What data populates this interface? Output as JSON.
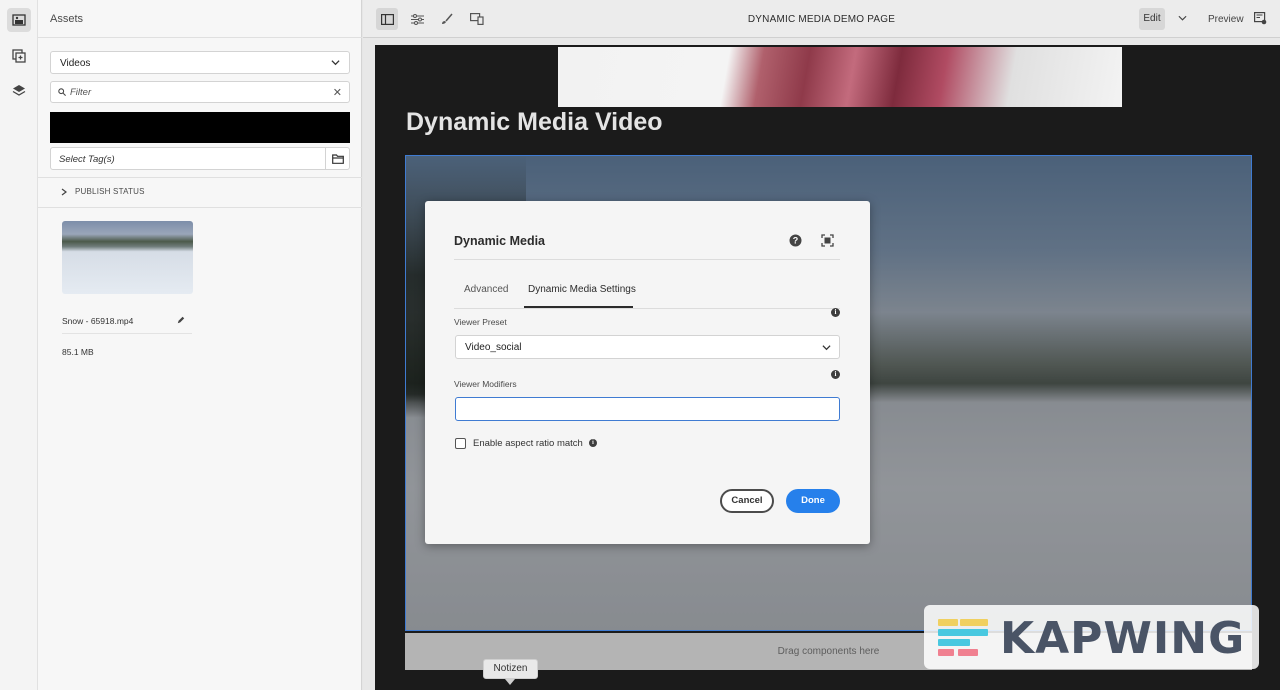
{
  "side_panel": {
    "title": "Assets",
    "asset_type": "Videos",
    "filter_placeholder": "Filter",
    "tags_placeholder": "Select Tag(s)",
    "publish_status": "PUBLISH STATUS",
    "asset": {
      "name": "Snow - 65918.mp4",
      "size": "85.1 MB"
    }
  },
  "toolbar": {
    "page_title": "DYNAMIC MEDIA DEMO PAGE",
    "edit_label": "Edit",
    "preview_label": "Preview"
  },
  "page": {
    "heading": "Dynamic Media Video",
    "drag_hint": "Drag components here"
  },
  "dialog": {
    "title": "Dynamic Media",
    "tabs": [
      {
        "label": "Advanced"
      },
      {
        "label": "Dynamic Media Settings"
      }
    ],
    "viewer_preset_label": "Viewer Preset",
    "viewer_preset_value": "Video_social",
    "viewer_modifiers_label": "Viewer Modifiers",
    "viewer_modifiers_value": "",
    "aspect_ratio_label": "Enable aspect ratio match",
    "cancel_label": "Cancel",
    "done_label": "Done"
  },
  "tooltip": "Notizen",
  "watermark": "KAPWING",
  "colors": {
    "accent": "#2680eb",
    "selection": "#3f7bd2"
  }
}
